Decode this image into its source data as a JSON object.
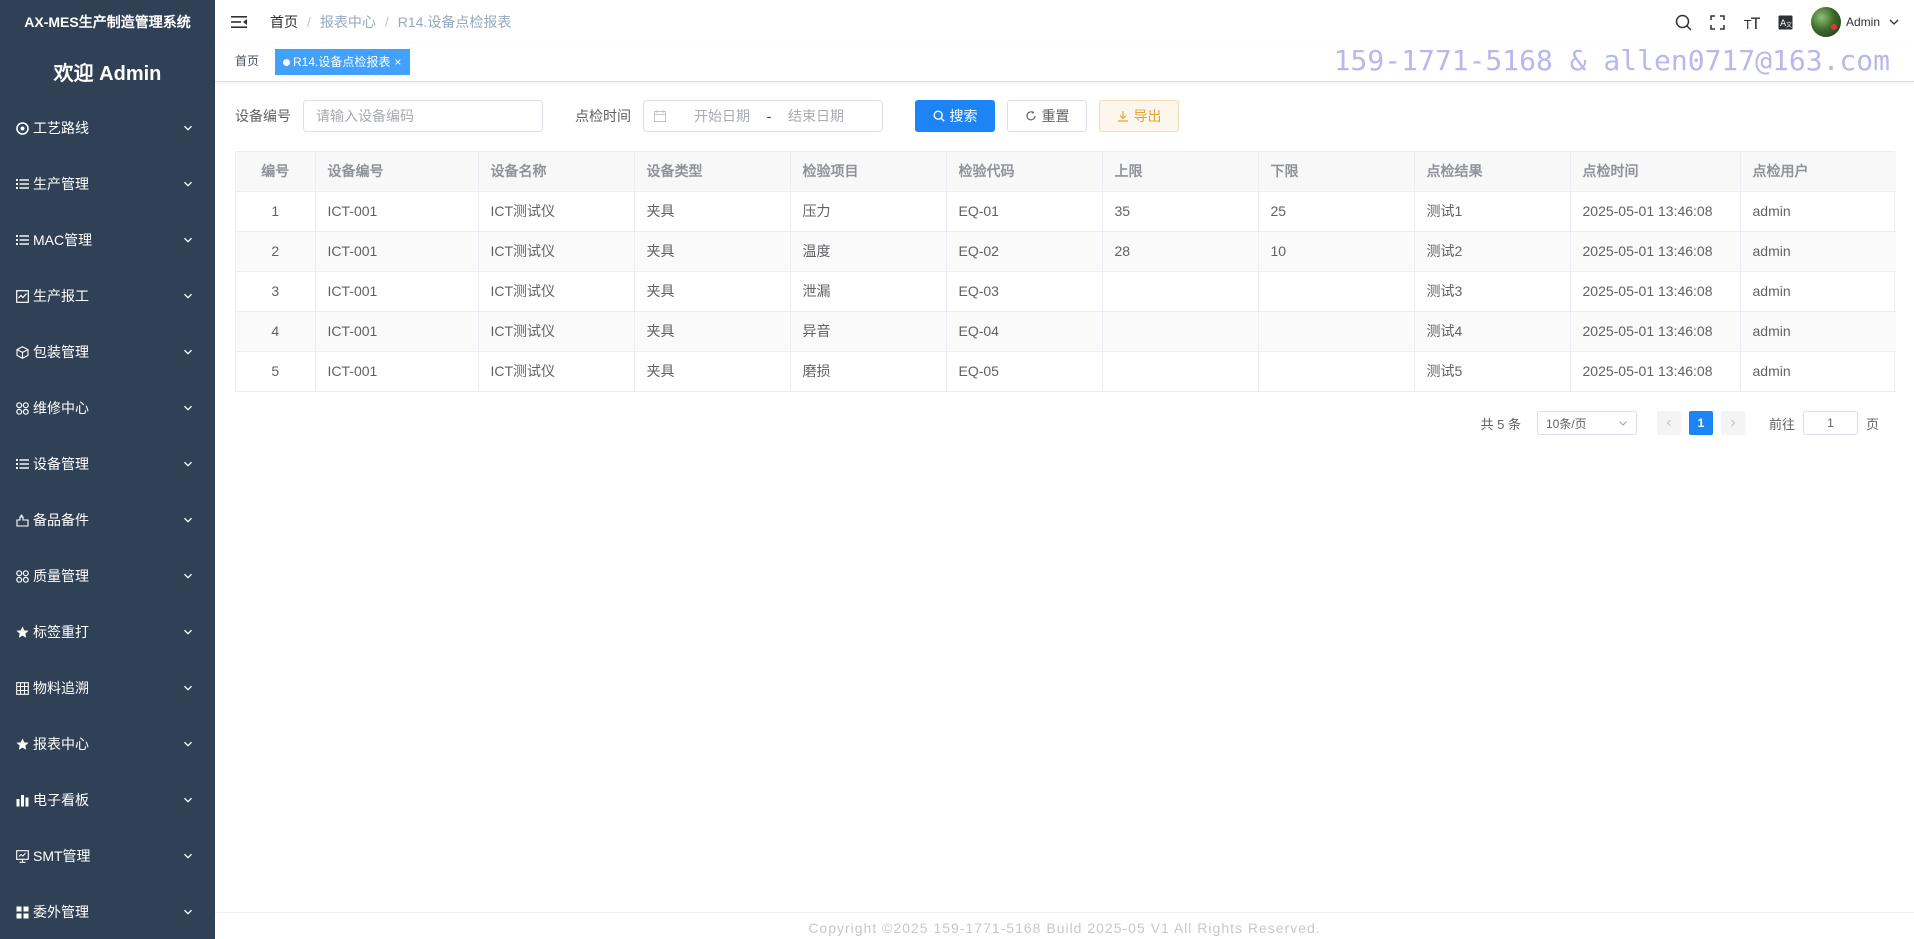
{
  "app": {
    "title": "AX-MES生产制造管理系统",
    "welcome": "欢迎 Admin"
  },
  "sidebar": {
    "items": [
      {
        "label": "工艺路线",
        "icon": "route-icon"
      },
      {
        "label": "生产管理",
        "icon": "list-icon"
      },
      {
        "label": "MAC管理",
        "icon": "list-icon"
      },
      {
        "label": "生产报工",
        "icon": "chart-check-icon"
      },
      {
        "label": "包装管理",
        "icon": "box-icon"
      },
      {
        "label": "维修中心",
        "icon": "grid-icon"
      },
      {
        "label": "设备管理",
        "icon": "list-icon"
      },
      {
        "label": "备品备件",
        "icon": "parts-icon"
      },
      {
        "label": "质量管理",
        "icon": "grid-icon"
      },
      {
        "label": "标签重打",
        "icon": "star-icon"
      },
      {
        "label": "物料追溯",
        "icon": "table-icon"
      },
      {
        "label": "报表中心",
        "icon": "star-icon"
      },
      {
        "label": "电子看板",
        "icon": "bar-chart-icon"
      },
      {
        "label": "SMT管理",
        "icon": "monitor-icon"
      },
      {
        "label": "委外管理",
        "icon": "apps-icon"
      }
    ]
  },
  "breadcrumb": [
    "首页",
    "报表中心",
    "R14.设备点检报表"
  ],
  "header": {
    "user": "Admin"
  },
  "tags": {
    "home": "首页",
    "active": "R14.设备点检报表"
  },
  "watermark": "159-1771-5168 & allen0717@163.com",
  "search": {
    "device_code_label": "设备编号",
    "device_code_placeholder": "请输入设备编码",
    "check_time_label": "点检时间",
    "start_placeholder": "开始日期",
    "range_separator": "-",
    "end_placeholder": "结束日期",
    "search_btn": "搜索",
    "reset_btn": "重置",
    "export_btn": "导出"
  },
  "table": {
    "headers": [
      "编号",
      "设备编号",
      "设备名称",
      "设备类型",
      "检验项目",
      "检验代码",
      "上限",
      "下限",
      "点检结果",
      "点检时间",
      "点检用户"
    ],
    "rows": [
      [
        "1",
        "ICT-001",
        "ICT测试仪",
        "夹具",
        "压力",
        "EQ-01",
        "35",
        "25",
        "测试1",
        "2025-05-01 13:46:08",
        "admin"
      ],
      [
        "2",
        "ICT-001",
        "ICT测试仪",
        "夹具",
        "温度",
        "EQ-02",
        "28",
        "10",
        "测试2",
        "2025-05-01 13:46:08",
        "admin"
      ],
      [
        "3",
        "ICT-001",
        "ICT测试仪",
        "夹具",
        "泄漏",
        "EQ-03",
        "",
        "",
        "测试3",
        "2025-05-01 13:46:08",
        "admin"
      ],
      [
        "4",
        "ICT-001",
        "ICT测试仪",
        "夹具",
        "异音",
        "EQ-04",
        "",
        "",
        "测试4",
        "2025-05-01 13:46:08",
        "admin"
      ],
      [
        "5",
        "ICT-001",
        "ICT测试仪",
        "夹具",
        "磨损",
        "EQ-05",
        "",
        "",
        "测试5",
        "2025-05-01 13:46:08",
        "admin"
      ]
    ]
  },
  "pagination": {
    "total": "共 5 条",
    "page_size": "10条/页",
    "current": "1",
    "goto_label": "前往",
    "goto_value": "1",
    "page_suffix": "页"
  },
  "footer": "Copyright ©2025 159-1771-5168 Build 2025-05 V1 All Rights Reserved.",
  "colors": {
    "sidebar_bg": "#304156",
    "primary": "#1c84f4",
    "tag_active": "#42a1fa",
    "warning": "#e6a23c"
  }
}
